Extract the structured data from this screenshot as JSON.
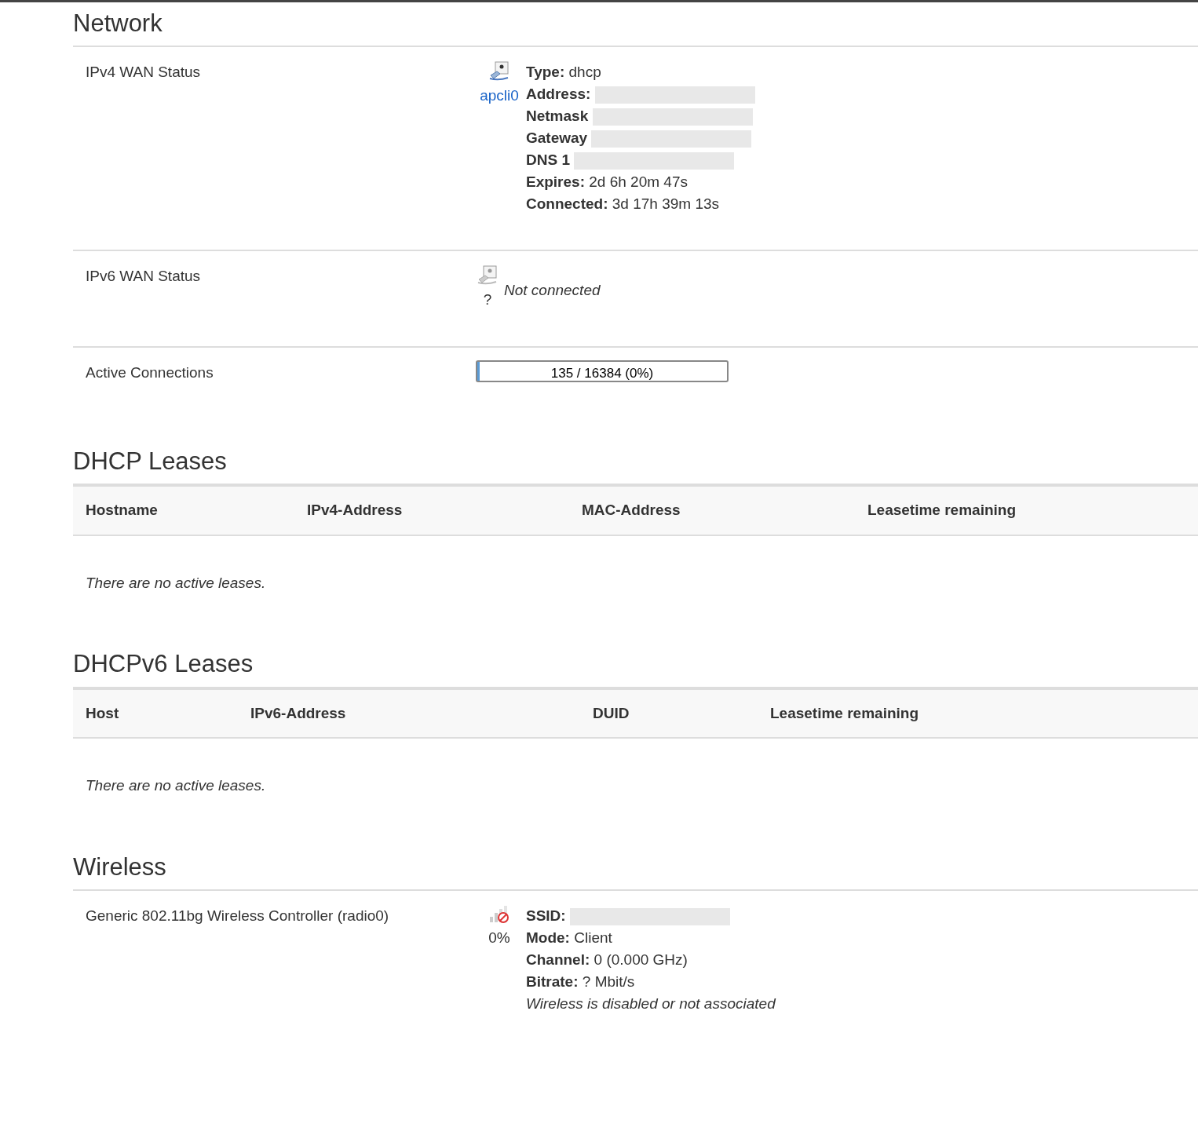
{
  "network": {
    "title": "Network",
    "ipv4": {
      "label": "IPv4 WAN Status",
      "interface": "apcli0",
      "connected": true,
      "details": [
        {
          "label": "Type:",
          "value": "dhcp",
          "redacted": false
        },
        {
          "label": "Address:",
          "redacted": true
        },
        {
          "label": "Netmask",
          "redacted": true
        },
        {
          "label": "Gateway",
          "redacted": true
        },
        {
          "label": "DNS 1",
          "redacted": true
        },
        {
          "label": "Expires:",
          "value": "2d 6h 20m 47s",
          "redacted": false
        },
        {
          "label": "Connected:",
          "value": "3d 17h 39m 13s",
          "redacted": false
        }
      ]
    },
    "ipv6": {
      "label": "IPv6 WAN Status",
      "interface": "?",
      "connected": false,
      "message": "Not connected"
    },
    "connections": {
      "label": "Active Connections",
      "reading": "135 / 16384 (0%)",
      "level": 0.008
    }
  },
  "dhcp": {
    "title": "DHCP Leases",
    "columns": [
      "Hostname",
      "IPv4-Address",
      "MAC-Address",
      "Leasetime remaining"
    ],
    "empty": "There are no active leases."
  },
  "dhcp6": {
    "title": "DHCPv6 Leases",
    "columns": [
      "Host",
      "IPv6-Address",
      "DUID",
      "Leasetime remaining"
    ],
    "empty": "There are no active leases."
  },
  "wireless": {
    "title": "Wireless",
    "device": "Generic 802.11bg Wireless Controller (radio0)",
    "signal": "0%",
    "enabled": false,
    "details": [
      {
        "label": "SSID:",
        "redacted": true
      },
      {
        "label": "Mode:",
        "value": "Client",
        "redacted": false
      },
      {
        "label": "Channel:",
        "value": "0 (0.000 GHz)",
        "redacted": false
      },
      {
        "label": "Bitrate:",
        "value": "? Mbit/s",
        "redacted": false
      }
    ],
    "note": "Wireless is disabled or not associated"
  }
}
